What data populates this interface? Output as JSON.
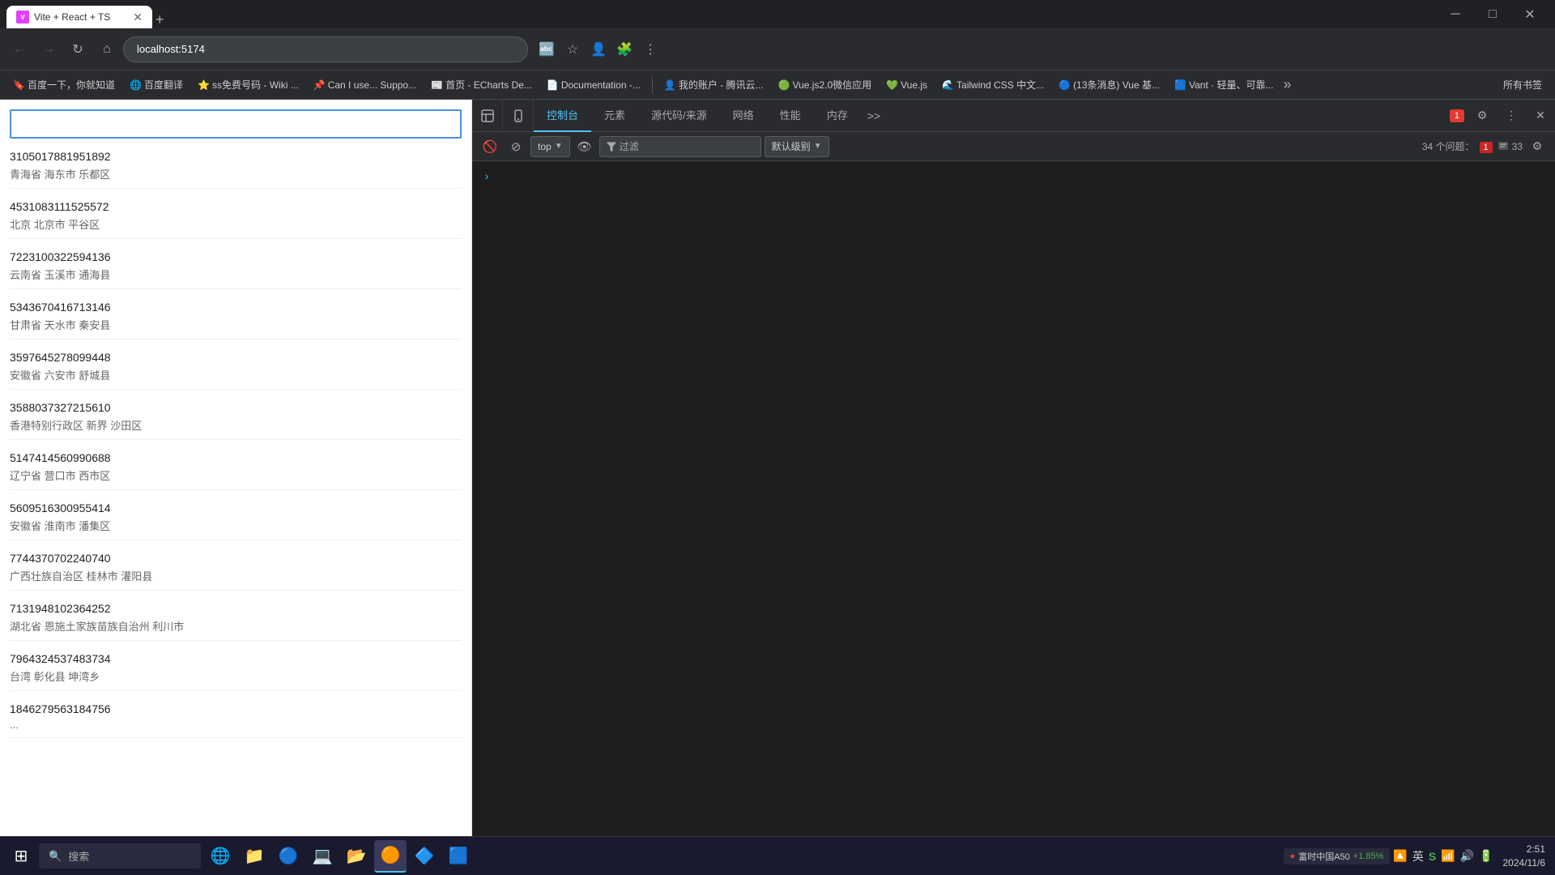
{
  "browser": {
    "tab": {
      "title": "Vite + React + TS",
      "favicon": "V"
    },
    "address": "localhost:5174",
    "window_controls": {
      "minimize": "─",
      "maximize": "□",
      "close": "✕"
    }
  },
  "bookmarks": {
    "items": [
      {
        "icon": "🔖",
        "label": "百度一下，你就知道"
      },
      {
        "icon": "🌐",
        "label": "百度翻译"
      },
      {
        "icon": "⭐",
        "label": "ss免费号码 - Wiki ..."
      },
      {
        "icon": "📌",
        "label": "Can I use... Suppo..."
      },
      {
        "icon": "📰",
        "label": "首页 - ECharts De..."
      },
      {
        "icon": "📄",
        "label": "Documentation -..."
      },
      {
        "icon": "👤",
        "label": "我的账户 - 腾讯云..."
      },
      {
        "icon": "🟢",
        "label": "Vue.js2.0微信应用"
      },
      {
        "icon": "💚",
        "label": "Vue.js"
      },
      {
        "icon": "🌊",
        "label": "Tailwind CSS 中文..."
      },
      {
        "icon": "🔵",
        "label": "(13条消息) Vue 基..."
      },
      {
        "icon": "🟦",
        "label": "Vant · 轻量、可靠..."
      }
    ],
    "more_label": "»",
    "all_bookmarks": "所有书签"
  },
  "website": {
    "search_placeholder": "",
    "data_items": [
      {
        "id": "3105017881951892",
        "address": "青海省 海东市 乐都区"
      },
      {
        "id": "4531083111525572",
        "address": "北京 北京市 平谷区"
      },
      {
        "id": "7223100322594136",
        "address": "云南省 玉溪市 通海县"
      },
      {
        "id": "5343670416713146",
        "address": "甘肃省 天水市 秦安县"
      },
      {
        "id": "3597645278099448",
        "address": "安徽省 六安市 舒城县"
      },
      {
        "id": "3588037327215610",
        "address": "香港特别行政区 新界 沙田区"
      },
      {
        "id": "5147414560990688",
        "address": "辽宁省 营口市 西市区"
      },
      {
        "id": "5609516300955414",
        "address": "安徽省 淮南市 潘集区"
      },
      {
        "id": "7744370702240740",
        "address": "广西壮族自治区 桂林市 灌阳县"
      },
      {
        "id": "7131948102364252",
        "address": "湖北省 恩施土家族苗族自治州 利川市"
      },
      {
        "id": "7964324537483734",
        "address": "台湾 彰化县 坤湾乡"
      },
      {
        "id": "1846279563184756",
        "address": "..."
      }
    ]
  },
  "devtools": {
    "tabs": [
      {
        "label": "控制台",
        "active": true
      },
      {
        "label": "元素",
        "active": false
      },
      {
        "label": "源代码/来源",
        "active": false
      },
      {
        "label": "网络",
        "active": false
      },
      {
        "label": "性能",
        "active": false
      },
      {
        "label": "内存",
        "active": false
      },
      {
        "label": ">>",
        "active": false
      }
    ],
    "toolbar_icons": {
      "inspect": "⊞",
      "device": "📱"
    },
    "error_count": "1",
    "console": {
      "top_label": "top",
      "filter_label": "过滤",
      "level_label": "默认级别",
      "issues_label": "34 个问题：",
      "error_count": "1",
      "warning_count": "33"
    }
  },
  "taskbar": {
    "search_placeholder": "搜索",
    "icons": [
      {
        "symbol": "⊞",
        "label": "start"
      },
      {
        "symbol": "🔍",
        "label": "search"
      },
      {
        "symbol": "🌐",
        "label": "taskview"
      },
      {
        "symbol": "📁",
        "label": "file-explorer"
      },
      {
        "symbol": "🔵",
        "label": "edge"
      },
      {
        "symbol": "💻",
        "label": "visual-studio"
      },
      {
        "symbol": "📁",
        "label": "files"
      },
      {
        "symbol": "🟠",
        "label": "chrome"
      },
      {
        "symbol": "🔷",
        "label": "vscode"
      },
      {
        "symbol": "🟦",
        "label": "terminal"
      }
    ],
    "stock": {
      "label": "富时中国A50",
      "change": "+1.85%"
    },
    "sys_icons": [
      "🔼",
      "英",
      "S",
      "🔔",
      "📶",
      "🔊",
      "🔋"
    ],
    "clock": {
      "time": "2:51",
      "date": "2024/11/6"
    }
  }
}
